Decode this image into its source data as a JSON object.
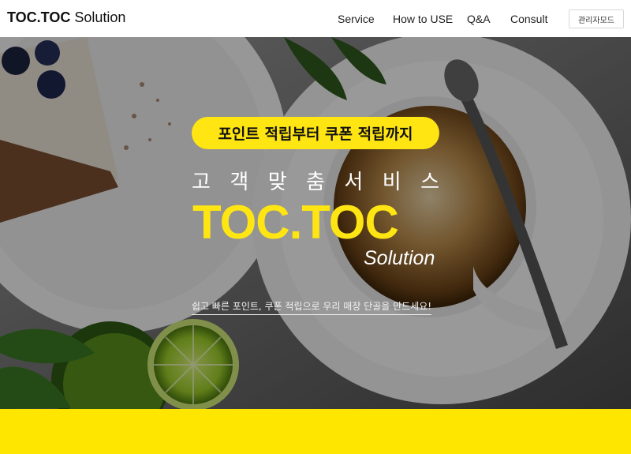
{
  "header": {
    "brand_bold": "TOC.TOC",
    "brand_light": "Solution",
    "nav": [
      "Service",
      "How to USE",
      "Q&A",
      "Consult"
    ],
    "admin_button": "관리자모드"
  },
  "hero": {
    "badge": "포인트 적립부터 쿠폰 적립까지",
    "spaced_chars": [
      "고",
      "객",
      "맞",
      "춤",
      "서",
      "비",
      "스"
    ],
    "title": "TOC.TOC",
    "subtitle": "Solution",
    "tagline": "쉽고 빠른 포인트, 쿠폰 적립으로 우리 매장 단골을 만드세요!"
  },
  "colors": {
    "accent_yellow": "#ffe512",
    "band_yellow": "#ffe600"
  }
}
